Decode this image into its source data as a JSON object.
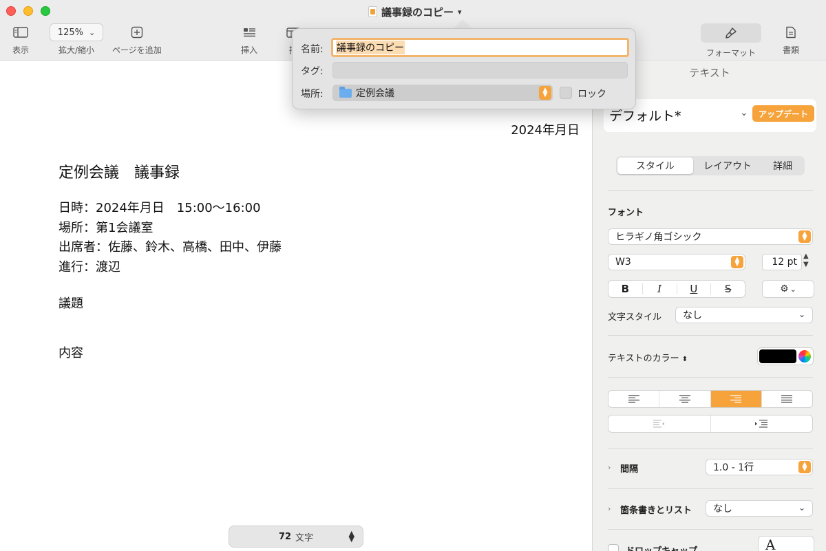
{
  "window": {
    "doc_title": "議事録のコピー",
    "title_chevron": "⌄"
  },
  "toolbar": {
    "view_label": "表示",
    "zoom_value": "125%",
    "zoom_label": "拡大/縮小",
    "add_page_label": "ページを追加",
    "insert_label": "挿入",
    "insert_label_partial": "挿",
    "format_label": "フォーマット",
    "document_label": "書類"
  },
  "popover": {
    "name_label": "名前:",
    "name_value": "議事録のコピー",
    "tag_label": "タグ:",
    "location_label": "場所:",
    "location_value": "定例会議",
    "lock_label": "ロック"
  },
  "document": {
    "date": "2024年月日",
    "heading": "定例会議　議事録",
    "lines": [
      "日時：2024年月日　15:00〜16:00",
      "場所：第1会議室",
      "出席者：佐藤、鈴木、高橋、田中、伊藤",
      "進行：渡辺"
    ],
    "agenda": "議題",
    "content": "内容",
    "word_count_number": "72",
    "word_count_unit": "文字"
  },
  "sidebar": {
    "tab_text": "テキスト",
    "style_name": "デフォルト*",
    "update_button": "アップデート",
    "style_tabs": [
      "スタイル",
      "レイアウト",
      "詳細"
    ],
    "font_section": "フォント",
    "font_family": "ヒラギノ角ゴシック",
    "font_weight": "W3",
    "font_size": "12 pt",
    "biu": [
      "B",
      "I",
      "U",
      "S"
    ],
    "char_style_label": "文字スタイル",
    "char_style_value": "なし",
    "text_color_label": "テキストのカラー",
    "text_color": "#000000",
    "spacing_label": "間隔",
    "spacing_value": "1.0 - 1行",
    "bullets_label": "箇条書きとリスト",
    "bullets_value": "なし",
    "dropcap_label": "ドロップキャップ",
    "dropcap_glyph": "A"
  },
  "colors": {
    "accent": "#f6a33b",
    "name_field_border": "#f3b46b"
  }
}
